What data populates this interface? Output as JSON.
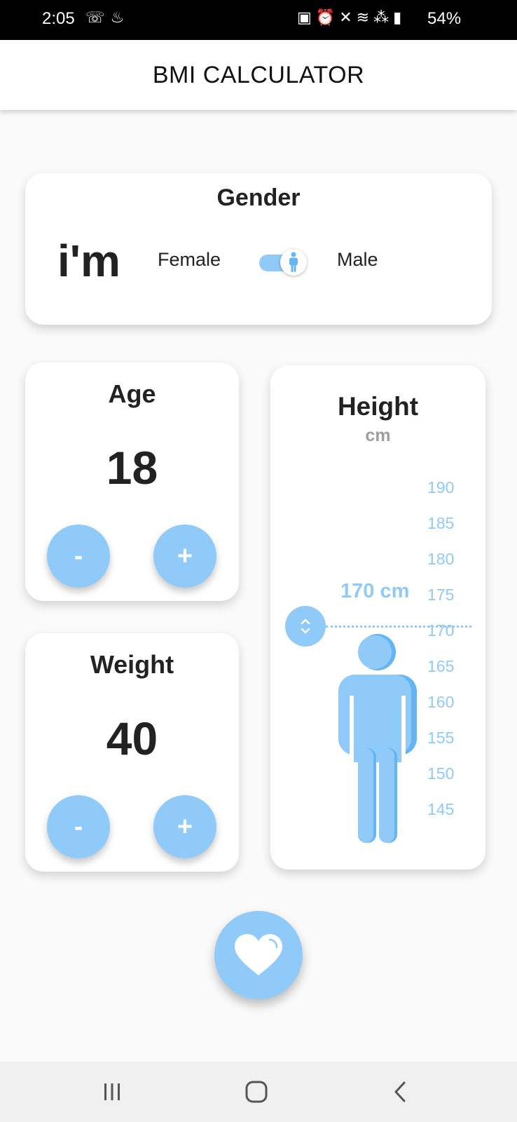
{
  "status_bar": {
    "time": "2:05",
    "left_icons": [
      "missed-call-icon",
      "notification-icon"
    ],
    "right_icons": [
      "sync-icon",
      "alarm-icon",
      "vibrate-icon",
      "wifi-icon",
      "volte-icon",
      "signal-icon"
    ],
    "battery": "54%"
  },
  "app_bar": {
    "title": "BMI CALCULATOR"
  },
  "gender": {
    "title": "Gender",
    "prefix": "i'm",
    "female_label": "Female",
    "male_label": "Male",
    "selected": "Male"
  },
  "age": {
    "title": "Age",
    "value": "18",
    "minus_label": "-",
    "plus_label": "+"
  },
  "weight": {
    "title": "Weight",
    "value": "40",
    "minus_label": "-",
    "plus_label": "+"
  },
  "height": {
    "title": "Height",
    "unit": "cm",
    "current": "170 cm",
    "scale": [
      "190",
      "185",
      "180",
      "175",
      "170",
      "165",
      "160",
      "155",
      "150",
      "145"
    ]
  },
  "colors": {
    "accent": "#90caf9",
    "figure": "#64b5f6",
    "text": "#222222",
    "background": "#fafafa"
  },
  "calculate_button": {
    "icon": "heart-icon"
  },
  "nav_bar": {
    "icons": [
      "recent-apps-icon",
      "home-icon",
      "back-icon"
    ]
  }
}
